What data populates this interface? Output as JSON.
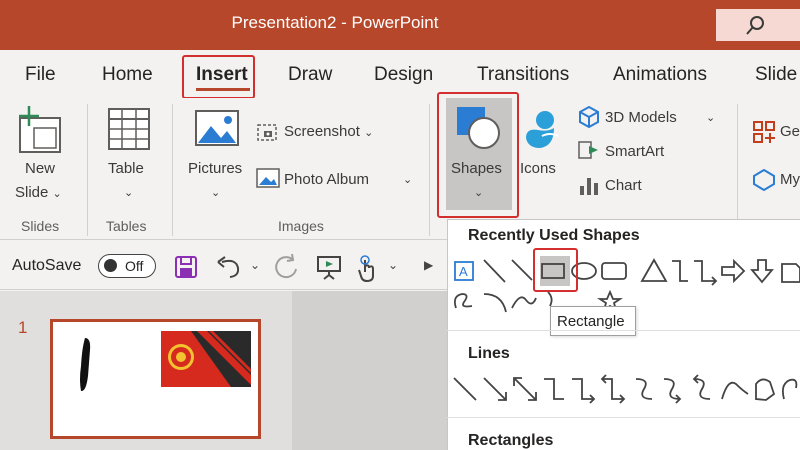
{
  "window": {
    "title": "Presentation2  -  PowerPoint",
    "search_icon": "search-icon"
  },
  "tabs": [
    "File",
    "Home",
    "Insert",
    "Draw",
    "Design",
    "Transitions",
    "Animations",
    "Slide"
  ],
  "active_tab": "Insert",
  "ribbon": {
    "slides": {
      "new_slide_line1": "New",
      "new_slide_line2": "Slide",
      "group": "Slides"
    },
    "tables": {
      "table": "Table",
      "group": "Tables"
    },
    "images": {
      "pictures": "Pictures",
      "screenshot": "Screenshot",
      "photo_album": "Photo Album",
      "group": "Images"
    },
    "illustrations": {
      "shapes": "Shapes",
      "icons": "Icons",
      "models_3d": "3D Models",
      "smartart": "SmartArt",
      "chart": "Chart"
    },
    "addins": {
      "get": "Ge",
      "my": "My"
    }
  },
  "qat": {
    "autosave_label": "AutoSave",
    "autosave_state": "Off"
  },
  "slide_pane": {
    "slide_number": "1"
  },
  "shapes_menu": {
    "recent_heading": "Recently Used Shapes",
    "lines_heading": "Lines",
    "rectangles_heading": "Rectangles",
    "tooltip": "Rectangle"
  },
  "colors": {
    "accent": "#b7472a",
    "highlight": "#d32f2f"
  }
}
